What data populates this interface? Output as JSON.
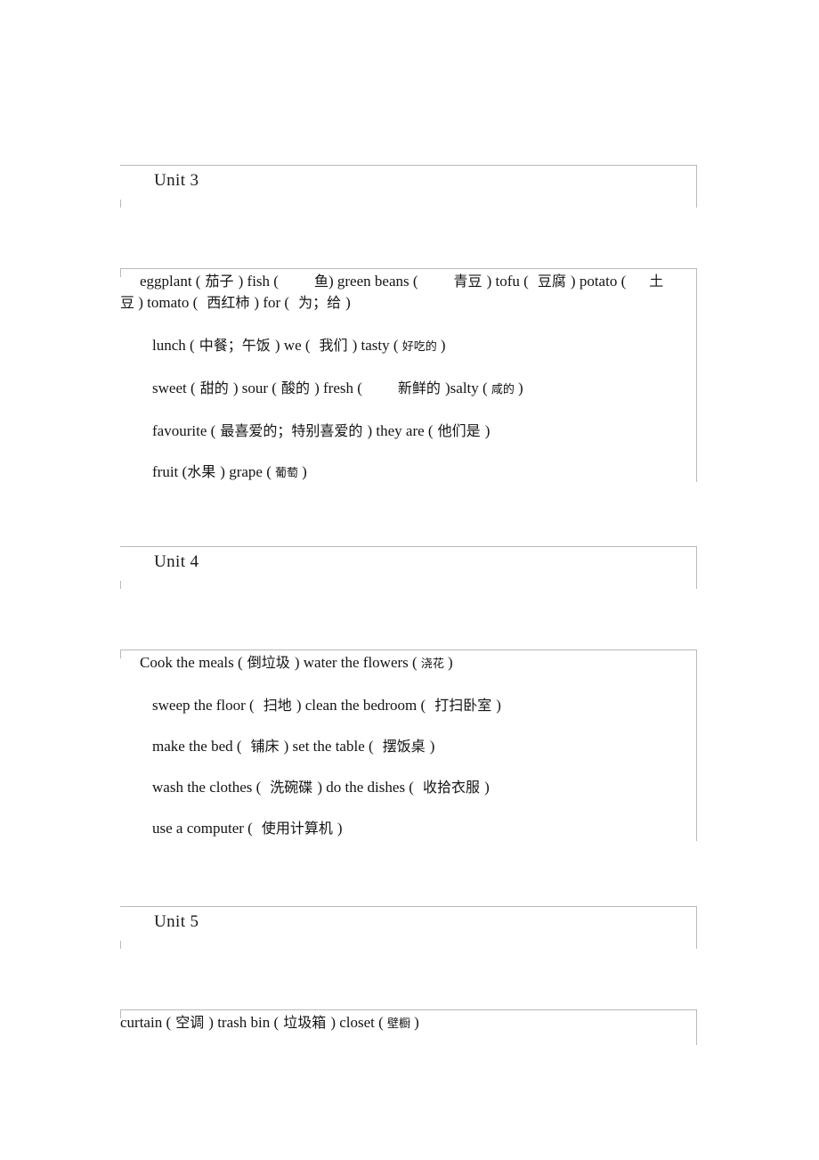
{
  "document": {
    "type": "vocabulary-worksheet",
    "border_color": "#b9b9b9",
    "text_color": "#141414"
  },
  "units": [
    {
      "title": "Unit 3",
      "lines": [
        {
          "id": "u3-l1",
          "text": "eggplant ( 茄子 ) fish (        鱼) green beans (        青豆 ) tofu (    豆腐 ) potato (    土",
          "segments": [
            {
              "t": "eggplant (",
              "s": "en"
            },
            {
              "t": " 茄子 ",
              "s": "cn"
            },
            {
              "t": ") fish (",
              "s": "en"
            },
            {
              "t": "        鱼",
              "s": "cn"
            },
            {
              "t": ") green beans (",
              "s": "en"
            },
            {
              "t": "        青豆 ",
              "s": "cn"
            },
            {
              "t": ") tofu (",
              "s": "en"
            },
            {
              "t": "    豆腐 ",
              "s": "cn"
            },
            {
              "t": ") potato (",
              "s": "en"
            },
            {
              "t": "    土",
              "s": "cn"
            }
          ]
        },
        {
          "id": "u3-l1b",
          "text": "豆 ) tomato (   西红柿 ) for (   为；给 )",
          "segments": [
            {
              "t": "豆",
              "s": "cn"
            },
            {
              "t": " ) tomato (",
              "s": "en"
            },
            {
              "t": "   西红柿 ",
              "s": "cn"
            },
            {
              "t": ") for (",
              "s": "en"
            },
            {
              "t": "   为；给 ",
              "s": "cn"
            },
            {
              "t": ")",
              "s": "en"
            }
          ]
        },
        {
          "id": "u3-l2",
          "text": "lunch ( 中餐；午饭 ) we (   我们 ) tasty ( 好吃的 )",
          "segments": [
            {
              "t": "lunch (",
              "s": "en"
            },
            {
              "t": " 中餐；午饭 ",
              "s": "cn"
            },
            {
              "t": ") we (",
              "s": "en"
            },
            {
              "t": "   我们 ",
              "s": "cn"
            },
            {
              "t": ") tasty (",
              "s": "en"
            },
            {
              "t": " 好吃的 ",
              "s": "cn-sm"
            },
            {
              "t": ")",
              "s": "en"
            }
          ]
        },
        {
          "id": "u3-l3",
          "text": "sweet (  甜的 ) sour ( 酸的  ) fresh (        新鲜的  )salty ( 咸的 )",
          "segments": [
            {
              "t": "sweet (",
              "s": "en"
            },
            {
              "t": "  甜的 ",
              "s": "cn"
            },
            {
              "t": ") sour (",
              "s": "en"
            },
            {
              "t": " 酸的  ",
              "s": "cn"
            },
            {
              "t": ") fresh (",
              "s": "en"
            },
            {
              "t": "        新鲜的  ",
              "s": "cn"
            },
            {
              "t": ")salty (",
              "s": "en"
            },
            {
              "t": " 咸的 ",
              "s": "cn-sm"
            },
            {
              "t": ")",
              "s": "en"
            }
          ]
        },
        {
          "id": "u3-l4",
          "text": "favourite ( 最喜爱的；特别喜爱的   ) they are ( 他们是 )",
          "segments": [
            {
              "t": "favourite (",
              "s": "en"
            },
            {
              "t": " 最喜爱的；特别喜爱的   ",
              "s": "cn"
            },
            {
              "t": ") they are (",
              "s": "en"
            },
            {
              "t": " 他们是 ",
              "s": "cn"
            },
            {
              "t": ")",
              "s": "en"
            }
          ]
        },
        {
          "id": "u3-l5",
          "text": "fruit (水果  ) grape ( 葡萄 )",
          "segments": [
            {
              "t": "fruit (",
              "s": "en"
            },
            {
              "t": "水果  ",
              "s": "cn"
            },
            {
              "t": ") grape (",
              "s": "en"
            },
            {
              "t": " 葡萄 ",
              "s": "cn-sm"
            },
            {
              "t": ")",
              "s": "en"
            }
          ]
        }
      ]
    },
    {
      "title": "Unit 4",
      "lines": [
        {
          "id": "u4-l1",
          "text": "Cook the meals (  倒垃圾  ) water the flowers (  浇花 )",
          "segments": [
            {
              "t": "Cook the meals (",
              "s": "en"
            },
            {
              "t": "  倒垃圾  ",
              "s": "cn"
            },
            {
              "t": ") water the flowers (",
              "s": "en"
            },
            {
              "t": "  浇花 ",
              "s": "cn-sm"
            },
            {
              "t": ")",
              "s": "en"
            }
          ]
        },
        {
          "id": "u4-l2",
          "text": "sweep the floor (   扫地  ) clean the bedroom (   打扫卧室  )",
          "segments": [
            {
              "t": "sweep the floor (",
              "s": "en"
            },
            {
              "t": "   扫地  ",
              "s": "cn"
            },
            {
              "t": ") clean the bedroom (",
              "s": "en"
            },
            {
              "t": "   打扫卧室  ",
              "s": "cn"
            },
            {
              "t": ")",
              "s": "en"
            }
          ]
        },
        {
          "id": "u4-l3",
          "text": "make the bed (   铺床  ) set the table (   摆饭桌 )",
          "segments": [
            {
              "t": "make the bed (",
              "s": "en"
            },
            {
              "t": "   铺床  ",
              "s": "cn"
            },
            {
              "t": ") set the table (",
              "s": "en"
            },
            {
              "t": "   摆饭桌 ",
              "s": "cn"
            },
            {
              "t": ")",
              "s": "en"
            }
          ]
        },
        {
          "id": "u4-l4",
          "text": "wash the clothes (   洗碗碟  ) do the dishes (   收拾衣服 )",
          "segments": [
            {
              "t": "wash the clothes (",
              "s": "en"
            },
            {
              "t": "   洗碗碟  ",
              "s": "cn"
            },
            {
              "t": ") do the dishes (",
              "s": "en"
            },
            {
              "t": "   收拾衣服 ",
              "s": "cn"
            },
            {
              "t": ")",
              "s": "en"
            }
          ]
        },
        {
          "id": "u4-l5",
          "text": "use a computer (   使用计算机 )",
          "segments": [
            {
              "t": "use a computer (",
              "s": "en"
            },
            {
              "t": "   使用计算机 ",
              "s": "cn"
            },
            {
              "t": ")",
              "s": "en"
            }
          ]
        }
      ]
    },
    {
      "title": "Unit 5",
      "lines": [
        {
          "id": "u5-l1",
          "text": "curtain ( 空调  ) trash bin ( 垃圾箱  ) closet ( 壁橱 )",
          "segments": [
            {
              "t": "curtain (",
              "s": "en"
            },
            {
              "t": " 空调  ",
              "s": "cn"
            },
            {
              "t": ") trash bin (",
              "s": "en"
            },
            {
              "t": " 垃圾箱  ",
              "s": "cn"
            },
            {
              "t": ") closet (",
              "s": "en"
            },
            {
              "t": " 壁橱 ",
              "s": "cn-sm"
            },
            {
              "t": ")",
              "s": "en"
            }
          ]
        }
      ]
    }
  ]
}
